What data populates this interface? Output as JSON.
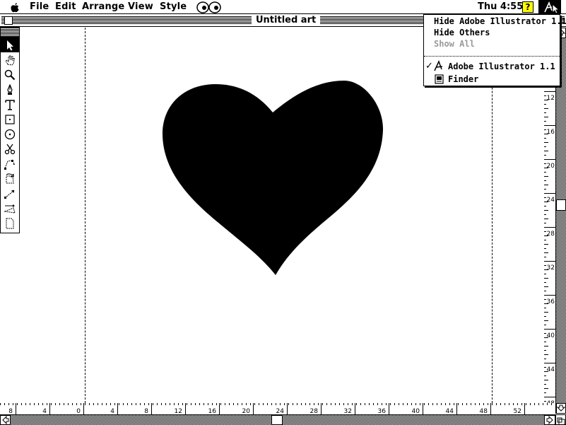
{
  "menubar": {
    "items": [
      "File",
      "Edit",
      "Arrange",
      "View",
      "Style"
    ],
    "clock": "Thu 4:55",
    "help_glyph": "?",
    "icons": [
      "apple-icon",
      "eyes-icon",
      "help-icon",
      "illustrator-app-icon"
    ]
  },
  "window": {
    "title": "Untitled art"
  },
  "toolbox": {
    "tools": [
      "selection-tool",
      "hand-tool",
      "zoom-tool",
      "pen-tool",
      "text-tool",
      "rectangle-tool",
      "oval-tool",
      "scissors-tool",
      "blend-tool",
      "rotate-tool",
      "scale-tool",
      "reflect-tool",
      "page-tool"
    ]
  },
  "app_menu": {
    "items": [
      {
        "label": "Hide Adobe Illustrator 1.1",
        "enabled": true
      },
      {
        "label": "Hide Others",
        "enabled": true
      },
      {
        "label": "Show All",
        "enabled": false
      }
    ],
    "apps": [
      {
        "label": "Adobe Illustrator 1.1",
        "checked": true,
        "icon": "illustrator-app-icon"
      },
      {
        "label": "Finder",
        "checked": false,
        "icon": "finder-icon"
      }
    ],
    "check_glyph": "✓"
  },
  "rulers": {
    "horizontal_labels": [
      "8",
      "4",
      "0",
      "4",
      "8",
      "12",
      "16",
      "20",
      "24",
      "28",
      "32",
      "36",
      "40",
      "44",
      "48",
      "52"
    ],
    "vertical_labels": [
      "12",
      "16",
      "20",
      "24",
      "28",
      "32",
      "36",
      "40",
      "44",
      "48"
    ]
  },
  "colors": {
    "artwork": "#000000",
    "help_icon_bg": "#ffff00",
    "disabled_text": "#9a9a9a"
  }
}
